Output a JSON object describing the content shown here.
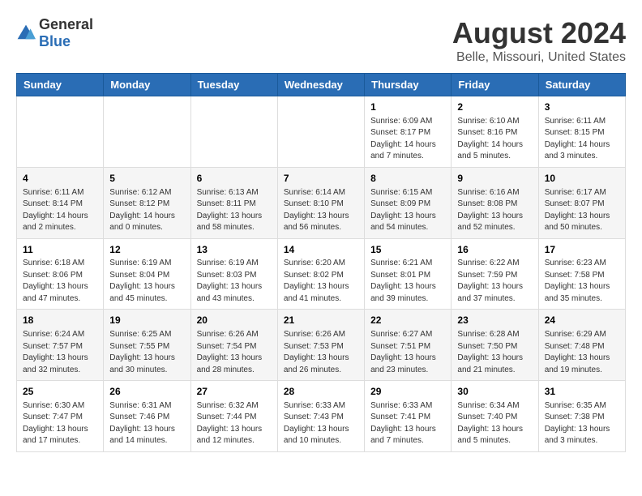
{
  "header": {
    "logo_general": "General",
    "logo_blue": "Blue",
    "month_year": "August 2024",
    "location": "Belle, Missouri, United States"
  },
  "weekdays": [
    "Sunday",
    "Monday",
    "Tuesday",
    "Wednesday",
    "Thursday",
    "Friday",
    "Saturday"
  ],
  "weeks": [
    [
      {
        "day": "",
        "info": ""
      },
      {
        "day": "",
        "info": ""
      },
      {
        "day": "",
        "info": ""
      },
      {
        "day": "",
        "info": ""
      },
      {
        "day": "1",
        "info": "Sunrise: 6:09 AM\nSunset: 8:17 PM\nDaylight: 14 hours\nand 7 minutes."
      },
      {
        "day": "2",
        "info": "Sunrise: 6:10 AM\nSunset: 8:16 PM\nDaylight: 14 hours\nand 5 minutes."
      },
      {
        "day": "3",
        "info": "Sunrise: 6:11 AM\nSunset: 8:15 PM\nDaylight: 14 hours\nand 3 minutes."
      }
    ],
    [
      {
        "day": "4",
        "info": "Sunrise: 6:11 AM\nSunset: 8:14 PM\nDaylight: 14 hours\nand 2 minutes."
      },
      {
        "day": "5",
        "info": "Sunrise: 6:12 AM\nSunset: 8:12 PM\nDaylight: 14 hours\nand 0 minutes."
      },
      {
        "day": "6",
        "info": "Sunrise: 6:13 AM\nSunset: 8:11 PM\nDaylight: 13 hours\nand 58 minutes."
      },
      {
        "day": "7",
        "info": "Sunrise: 6:14 AM\nSunset: 8:10 PM\nDaylight: 13 hours\nand 56 minutes."
      },
      {
        "day": "8",
        "info": "Sunrise: 6:15 AM\nSunset: 8:09 PM\nDaylight: 13 hours\nand 54 minutes."
      },
      {
        "day": "9",
        "info": "Sunrise: 6:16 AM\nSunset: 8:08 PM\nDaylight: 13 hours\nand 52 minutes."
      },
      {
        "day": "10",
        "info": "Sunrise: 6:17 AM\nSunset: 8:07 PM\nDaylight: 13 hours\nand 50 minutes."
      }
    ],
    [
      {
        "day": "11",
        "info": "Sunrise: 6:18 AM\nSunset: 8:06 PM\nDaylight: 13 hours\nand 47 minutes."
      },
      {
        "day": "12",
        "info": "Sunrise: 6:19 AM\nSunset: 8:04 PM\nDaylight: 13 hours\nand 45 minutes."
      },
      {
        "day": "13",
        "info": "Sunrise: 6:19 AM\nSunset: 8:03 PM\nDaylight: 13 hours\nand 43 minutes."
      },
      {
        "day": "14",
        "info": "Sunrise: 6:20 AM\nSunset: 8:02 PM\nDaylight: 13 hours\nand 41 minutes."
      },
      {
        "day": "15",
        "info": "Sunrise: 6:21 AM\nSunset: 8:01 PM\nDaylight: 13 hours\nand 39 minutes."
      },
      {
        "day": "16",
        "info": "Sunrise: 6:22 AM\nSunset: 7:59 PM\nDaylight: 13 hours\nand 37 minutes."
      },
      {
        "day": "17",
        "info": "Sunrise: 6:23 AM\nSunset: 7:58 PM\nDaylight: 13 hours\nand 35 minutes."
      }
    ],
    [
      {
        "day": "18",
        "info": "Sunrise: 6:24 AM\nSunset: 7:57 PM\nDaylight: 13 hours\nand 32 minutes."
      },
      {
        "day": "19",
        "info": "Sunrise: 6:25 AM\nSunset: 7:55 PM\nDaylight: 13 hours\nand 30 minutes."
      },
      {
        "day": "20",
        "info": "Sunrise: 6:26 AM\nSunset: 7:54 PM\nDaylight: 13 hours\nand 28 minutes."
      },
      {
        "day": "21",
        "info": "Sunrise: 6:26 AM\nSunset: 7:53 PM\nDaylight: 13 hours\nand 26 minutes."
      },
      {
        "day": "22",
        "info": "Sunrise: 6:27 AM\nSunset: 7:51 PM\nDaylight: 13 hours\nand 23 minutes."
      },
      {
        "day": "23",
        "info": "Sunrise: 6:28 AM\nSunset: 7:50 PM\nDaylight: 13 hours\nand 21 minutes."
      },
      {
        "day": "24",
        "info": "Sunrise: 6:29 AM\nSunset: 7:48 PM\nDaylight: 13 hours\nand 19 minutes."
      }
    ],
    [
      {
        "day": "25",
        "info": "Sunrise: 6:30 AM\nSunset: 7:47 PM\nDaylight: 13 hours\nand 17 minutes."
      },
      {
        "day": "26",
        "info": "Sunrise: 6:31 AM\nSunset: 7:46 PM\nDaylight: 13 hours\nand 14 minutes."
      },
      {
        "day": "27",
        "info": "Sunrise: 6:32 AM\nSunset: 7:44 PM\nDaylight: 13 hours\nand 12 minutes."
      },
      {
        "day": "28",
        "info": "Sunrise: 6:33 AM\nSunset: 7:43 PM\nDaylight: 13 hours\nand 10 minutes."
      },
      {
        "day": "29",
        "info": "Sunrise: 6:33 AM\nSunset: 7:41 PM\nDaylight: 13 hours\nand 7 minutes."
      },
      {
        "day": "30",
        "info": "Sunrise: 6:34 AM\nSunset: 7:40 PM\nDaylight: 13 hours\nand 5 minutes."
      },
      {
        "day": "31",
        "info": "Sunrise: 6:35 AM\nSunset: 7:38 PM\nDaylight: 13 hours\nand 3 minutes."
      }
    ]
  ]
}
